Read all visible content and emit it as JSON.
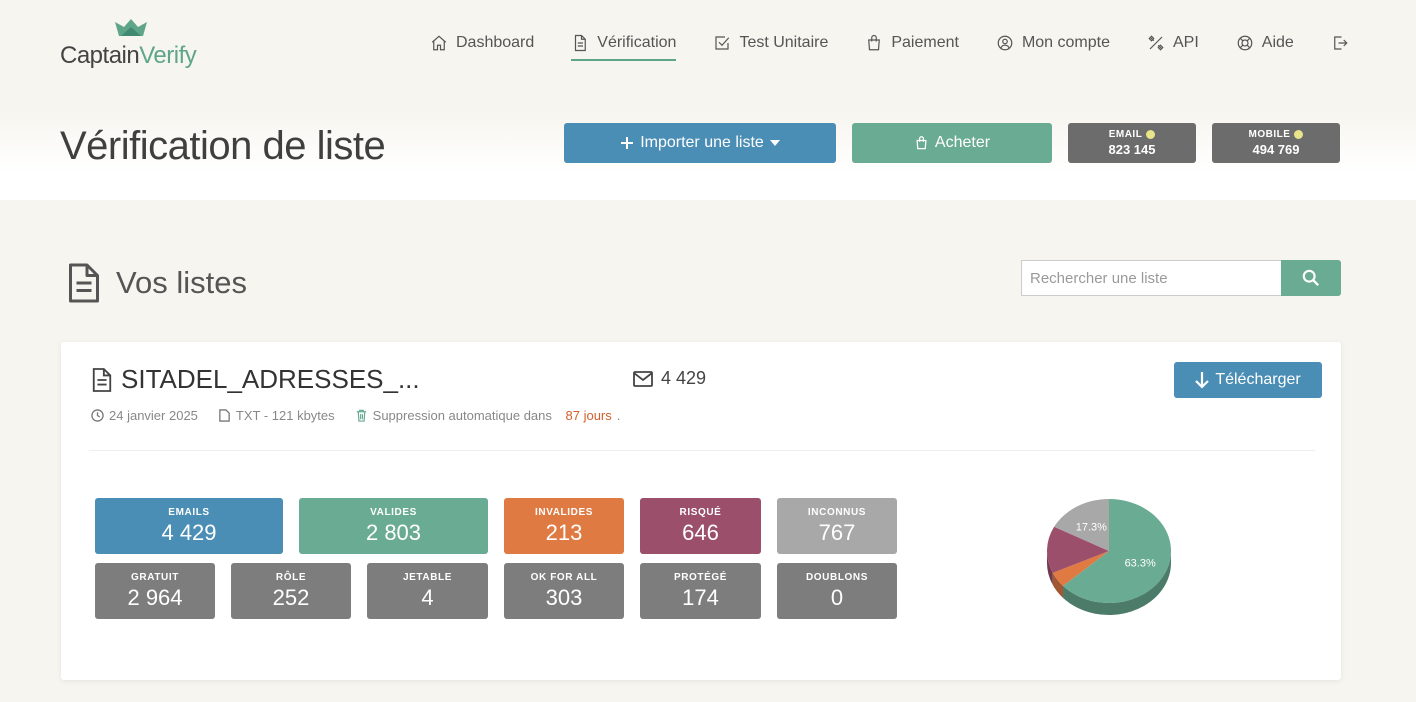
{
  "brand": {
    "part1": "Captain",
    "part2": "Verify"
  },
  "nav": [
    {
      "label": "Dashboard",
      "icon": "home-icon",
      "active": false
    },
    {
      "label": "Vérification",
      "icon": "document-icon",
      "active": true
    },
    {
      "label": "Test Unitaire",
      "icon": "checkbox-icon",
      "active": false
    },
    {
      "label": "Paiement",
      "icon": "bag-icon",
      "active": false
    },
    {
      "label": "Mon compte",
      "icon": "user-circle-icon",
      "active": false
    },
    {
      "label": "API",
      "icon": "tools-icon",
      "active": false
    },
    {
      "label": "Aide",
      "icon": "lifebuoy-icon",
      "active": false
    },
    {
      "label": "",
      "icon": "logout-icon",
      "active": false
    }
  ],
  "header": {
    "title": "Vérification de liste",
    "import_label": "Importer une liste",
    "buy_label": "Acheter",
    "credits": {
      "email_label": "EMAIL",
      "email_value": "823 145",
      "mobile_label": "MOBILE",
      "mobile_value": "494 769"
    }
  },
  "section": {
    "title": "Vos listes",
    "search_placeholder": "Rechercher une liste"
  },
  "list": {
    "name": "SITADEL_ADRESSES_...",
    "email_count": "4 429",
    "download_label": "Télécharger",
    "date": "24 janvier 2025",
    "file_info": "TXT - 121 kbytes",
    "deletion_prefix": "Suppression automatique dans",
    "deletion_days": "87 jours",
    "deletion_suffix": "."
  },
  "stats": {
    "emails": {
      "label": "EMAILS",
      "value": "4 429"
    },
    "valides": {
      "label": "VALIDES",
      "value": "2 803"
    },
    "invalides": {
      "label": "INVALIDES",
      "value": "213"
    },
    "risque": {
      "label": "RISQUÉ",
      "value": "646"
    },
    "inconnus": {
      "label": "INCONNUS",
      "value": "767"
    },
    "gratuit": {
      "label": "GRATUIT",
      "value": "2 964"
    },
    "role": {
      "label": "RÔLE",
      "value": "252"
    },
    "jetable": {
      "label": "JETABLE",
      "value": "4"
    },
    "okforall": {
      "label": "OK FOR ALL",
      "value": "303"
    },
    "protege": {
      "label": "PROTÉGÉ",
      "value": "174"
    },
    "doublons": {
      "label": "DOUBLONS",
      "value": "0"
    }
  },
  "colors": {
    "blue": "#4a8db5",
    "green": "#6aab93",
    "orange": "#e07a43",
    "wine": "#9b4f6a",
    "lightgray": "#a8a8a8",
    "gray": "#7d7d7d"
  },
  "chart_data": {
    "type": "pie",
    "slices": [
      {
        "value": 63.3,
        "label": "63.3%",
        "color": "#6aab93"
      },
      {
        "value": 4.8,
        "label": "",
        "color": "#e07a43"
      },
      {
        "value": 14.6,
        "label": "",
        "color": "#9b4f6a"
      },
      {
        "value": 17.3,
        "label": "17.3%",
        "color": "#a8a8a8"
      }
    ]
  }
}
